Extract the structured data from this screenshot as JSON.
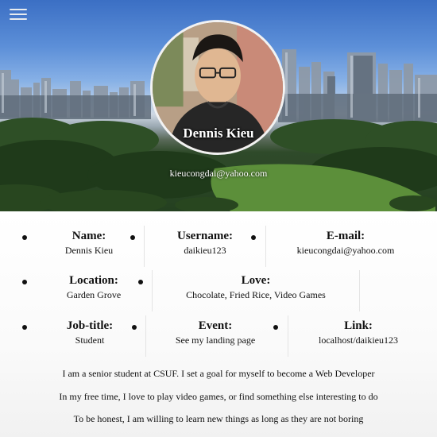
{
  "profile": {
    "name": "Dennis Kieu",
    "email": "kieucongdai@yahoo.com"
  },
  "menu": {
    "icon": "hamburger-menu-icon"
  },
  "fields": {
    "name": {
      "label": "Name:",
      "value": "Dennis Kieu"
    },
    "username": {
      "label": "Username:",
      "value": "daikieu123"
    },
    "email": {
      "label": "E-mail:",
      "value": "kieucongdai@yahoo.com"
    },
    "location": {
      "label": "Location:",
      "value": "Garden Grove"
    },
    "love": {
      "label": "Love:",
      "value": "Chocolate, Fried Rice, Video Games"
    },
    "jobtitle": {
      "label": "Job-title:",
      "value": "Student"
    },
    "event": {
      "label": "Event:",
      "value": "See my landing page"
    },
    "link": {
      "label": "Link:",
      "value": "localhost/daikieu123"
    }
  },
  "about": [
    "I am a senior student at CSUF. I set a goal for myself to become a Web Developer",
    "In my free time, I love to play video games, or find something else interesting to do",
    "To be honest, I am willing to learn new things as long as they are not boring"
  ]
}
